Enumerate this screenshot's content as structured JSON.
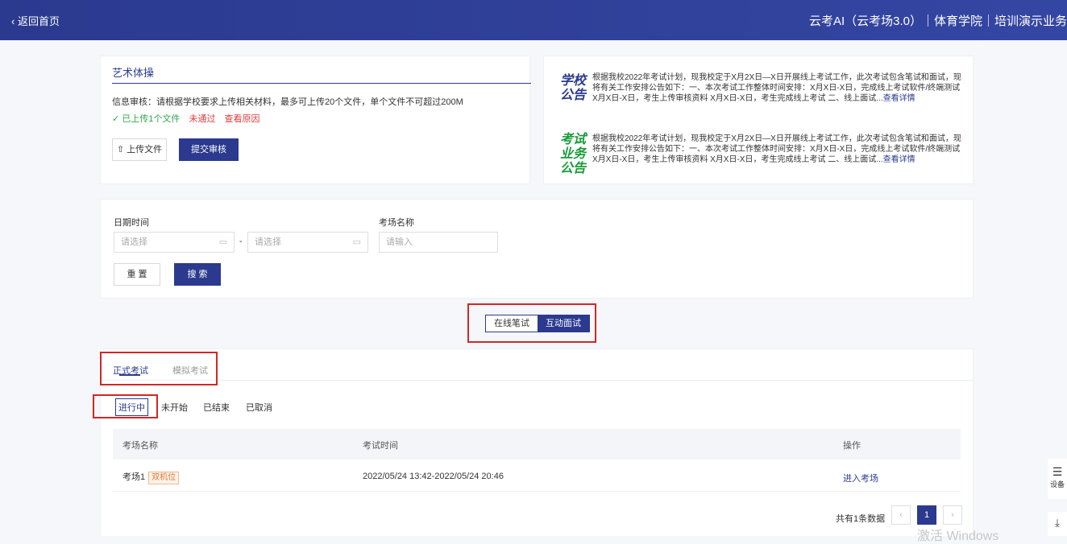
{
  "header": {
    "back_label": "返回首页",
    "back_icon": "chevron-left-icon",
    "title": "云考AI（云考场3.0）｜体育学院｜培训演示业务"
  },
  "upload_card": {
    "title": "艺术体操",
    "info": "信息审核：请根据学校要求上传相关材料，最多可上传20个文件，单个文件不可超过200M",
    "uploaded": "✓ 已上传1个文件",
    "fail_status": "未通过",
    "reason_link": "查看原因",
    "upload_button": "上传文件",
    "submit_button": "提交审核"
  },
  "notices": [
    {
      "tag": "学校\n公告",
      "text": "根据我校2022年考试计划，现我校定于X月2X日—X日开展线上考试工作，此次考试包含笔试和面试，现将有关工作安排公告如下：一、本次考试工作整体时间安排：X月X日-X日，完成线上考试软件/终端测试 X月X日-X日，考生上传审核资料 X月X日-X日，考生完成线上考试 二、线上面试...",
      "more": "查看详情"
    },
    {
      "tag": "考试\n业务\n公告",
      "text": "根据我校2022年考试计划，现我校定于X月2X日—X日开展线上考试工作，此次考试包含笔试和面试，现将有关工作安排公告如下：一、本次考试工作整体时间安排：X月X日-X日，完成线上考试软件/终端测试 X月X日-X日，考生上传审核资料 X月X日-X日，考生完成线上考试 二、线上面试...",
      "more": "查看详情"
    }
  ],
  "filters": {
    "date_label": "日期时间",
    "start_placeholder": "请选择",
    "separator": "-",
    "end_placeholder": "请选择",
    "name_label": "考场名称",
    "name_placeholder": "请输入",
    "reset_button": "重 置",
    "search_button": "搜 索"
  },
  "mode_switch": {
    "options": [
      "在线笔试",
      "互动面试"
    ],
    "selected": "互动面试"
  },
  "exam_tabs": {
    "items": [
      "正式考试",
      "模拟考试"
    ],
    "selected": "正式考试"
  },
  "status_tabs": {
    "items": [
      "进行中",
      "未开始",
      "已结束",
      "已取消"
    ],
    "selected": "进行中"
  },
  "table": {
    "columns": [
      "考场名称",
      "考试时间",
      "操作"
    ],
    "rows": [
      {
        "name": "考场1",
        "badge": "双机位",
        "time": "2022/05/24 13:42-2022/05/24 20:46",
        "action": "进入考场"
      }
    ]
  },
  "pagination": {
    "total_text": "共有1条数据",
    "current_page": "1",
    "prev": "‹",
    "next": "›"
  },
  "side_float": {
    "device_label": "设备",
    "icon": "menu-icon",
    "download_icon": "download-icon"
  },
  "watermark": "激活 Windows",
  "colors": {
    "primary": "#2b3a8f",
    "danger": "#e33b3b",
    "success": "#2fa84f",
    "notice_green": "#1a9b3a"
  }
}
